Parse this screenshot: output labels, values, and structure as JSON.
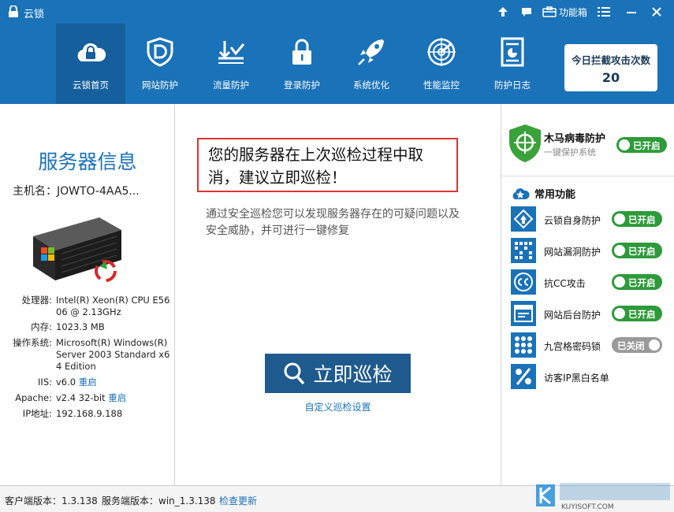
{
  "titlebar": {
    "app_name": "云锁",
    "toolbox_label": "功能箱",
    "icons": [
      "upload-icon",
      "message-icon",
      "toolbox-icon",
      "menu-icon",
      "minimize-icon",
      "close-icon"
    ]
  },
  "nav": {
    "items": [
      {
        "label": "云锁首页",
        "icon": "cloud-lock-icon",
        "active": true
      },
      {
        "label": "网站防护",
        "icon": "shield-d-icon"
      },
      {
        "label": "流量防护",
        "icon": "traffic-icon"
      },
      {
        "label": "登录防护",
        "icon": "padlock-icon"
      },
      {
        "label": "系统优化",
        "icon": "rocket-icon"
      },
      {
        "label": "性能监控",
        "icon": "radar-icon"
      },
      {
        "label": "防护日志",
        "icon": "log-document-icon"
      }
    ],
    "counter": {
      "label": "今日拦截攻击次数",
      "value": "20"
    }
  },
  "server": {
    "title": "服务器信息",
    "hostname": "主机名：JOWTO-4AA5...",
    "specs": [
      {
        "key": "处理器:",
        "value": "Intel(R) Xeon(R) CPU E5606  @ 2.13GHz"
      },
      {
        "key": "内存:",
        "value": "1023.3 MB"
      },
      {
        "key": "操作系统:",
        "value": "Microsoft(R) Windows(R) Server 2003 Standard x64 Edition"
      },
      {
        "key": "IIS:",
        "value": "v6.0",
        "action": "重启"
      },
      {
        "key": "Apache:",
        "value": "v2.4 32-bit",
        "action": "重启"
      },
      {
        "key": "IP地址:",
        "value": "192.168.9.188"
      }
    ]
  },
  "main": {
    "alert": "您的服务器在上次巡检过程中取消，建议立即巡检！",
    "description": "通过安全巡检您可以发现服务器存在的可疑问题以及安全威胁，并可进行一键修复",
    "scan_button": "立即巡检",
    "scan_settings": "自定义巡检设置"
  },
  "right": {
    "trojan": {
      "title": "木马病毒防护",
      "subtitle": "一键保护系统",
      "status": "已开启"
    },
    "favorites_title": "常用功能",
    "features": [
      {
        "label": "云锁自身防护",
        "status": "已开启",
        "on": true,
        "icon": "self-protect-icon"
      },
      {
        "label": "网站漏洞防护",
        "status": "已开启",
        "on": true,
        "icon": "vulnerability-icon"
      },
      {
        "label": "抗CC攻击",
        "status": "已开启",
        "on": true,
        "icon": "cc-icon"
      },
      {
        "label": "网站后台防护",
        "status": "已开启",
        "on": true,
        "icon": "backend-icon"
      },
      {
        "label": "九宫格密码锁",
        "status": "已关闭",
        "on": false,
        "icon": "grid-lock-icon"
      },
      {
        "label": "访客IP黑白名单",
        "icon": "ip-list-icon"
      }
    ]
  },
  "status_bar": {
    "client_version": "客户端版本：1.3.138",
    "server_version": "服务端版本：win_1.3.138",
    "check_update": "检查更新"
  },
  "watermark": "KUYISOFT.COM",
  "colors": {
    "brand": "#1a72b8",
    "nav_active": "#155f9c",
    "toggle_on": "#2e9a3a",
    "toggle_off": "#9a9a9a",
    "alert_border": "#dd3333"
  }
}
